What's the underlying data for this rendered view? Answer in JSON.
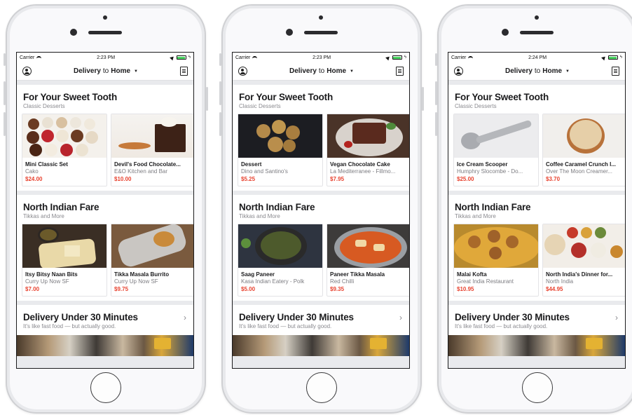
{
  "phones": [
    {
      "status": {
        "carrier": "Carrier",
        "time": "2:23 PM"
      },
      "nav": {
        "prefix": "Delivery",
        "to": "to",
        "location": "Home"
      },
      "sections": [
        {
          "title": "For Your Sweet Tooth",
          "subtitle": "Classic Desserts",
          "cards": [
            {
              "name": "Mini Classic Set",
              "store": "Cako",
              "price": "$24.00"
            },
            {
              "name": "Devil's Food Chocolate...",
              "store": "E&O Kitchen and Bar",
              "price": "$10.00"
            }
          ]
        },
        {
          "title": "North Indian Fare",
          "subtitle": "Tikkas and More",
          "cards": [
            {
              "name": "Itsy Bitsy Naan Bits",
              "store": "Curry Up Now SF",
              "price": "$7.00"
            },
            {
              "name": "Tikka Masala Burrito",
              "store": "Curry Up Now SF",
              "price": "$9.75"
            }
          ]
        }
      ],
      "delivery": {
        "title": "Delivery Under 30 Minutes",
        "subtitle": "It's like fast food — but actually good."
      }
    },
    {
      "status": {
        "carrier": "Carrier",
        "time": "2:23 PM"
      },
      "nav": {
        "prefix": "Delivery",
        "to": "to",
        "location": "Home"
      },
      "sections": [
        {
          "title": "For Your Sweet Tooth",
          "subtitle": "Classic Desserts",
          "cards": [
            {
              "name": "Dessert",
              "store": "Dino and Santino's",
              "price": "$5.25"
            },
            {
              "name": "Vegan Chocolate Cake",
              "store": "La Mediterranee - Fillmo...",
              "price": "$7.95"
            }
          ]
        },
        {
          "title": "North Indian Fare",
          "subtitle": "Tikkas and More",
          "cards": [
            {
              "name": "Saag Paneer",
              "store": "Kasa Indian Eatery - Polk",
              "price": "$5.00"
            },
            {
              "name": "Paneer Tikka Masala",
              "store": "Red Chilli",
              "price": "$9.35"
            }
          ]
        }
      ],
      "delivery": {
        "title": "Delivery Under 30 Minutes",
        "subtitle": "It's like fast food — but actually good."
      }
    },
    {
      "status": {
        "carrier": "Carrier",
        "time": "2:24 PM"
      },
      "nav": {
        "prefix": "Delivery",
        "to": "to",
        "location": "Home"
      },
      "sections": [
        {
          "title": "For Your Sweet Tooth",
          "subtitle": "Classic Desserts",
          "cards": [
            {
              "name": "Ice Cream Scooper",
              "store": "Humphry Slocombe - Do...",
              "price": "$25.00"
            },
            {
              "name": "Coffee Caramel Crunch I...",
              "store": "Over The Moon Creamer...",
              "price": "$3.70"
            }
          ]
        },
        {
          "title": "North Indian Fare",
          "subtitle": "Tikkas and More",
          "cards": [
            {
              "name": "Malai Kofta",
              "store": "Great India Restaurant",
              "price": "$10.95"
            },
            {
              "name": "North India's Dinner for...",
              "store": "North India",
              "price": "$44.95"
            }
          ]
        }
      ],
      "delivery": {
        "title": "Delivery Under 30 Minutes",
        "subtitle": "It's like fast food — but actually good."
      }
    }
  ],
  "colors": {
    "price": "#e8422f",
    "battery": "#4cd964",
    "text": "#1b1b1d",
    "muted": "#8a8a8f"
  }
}
